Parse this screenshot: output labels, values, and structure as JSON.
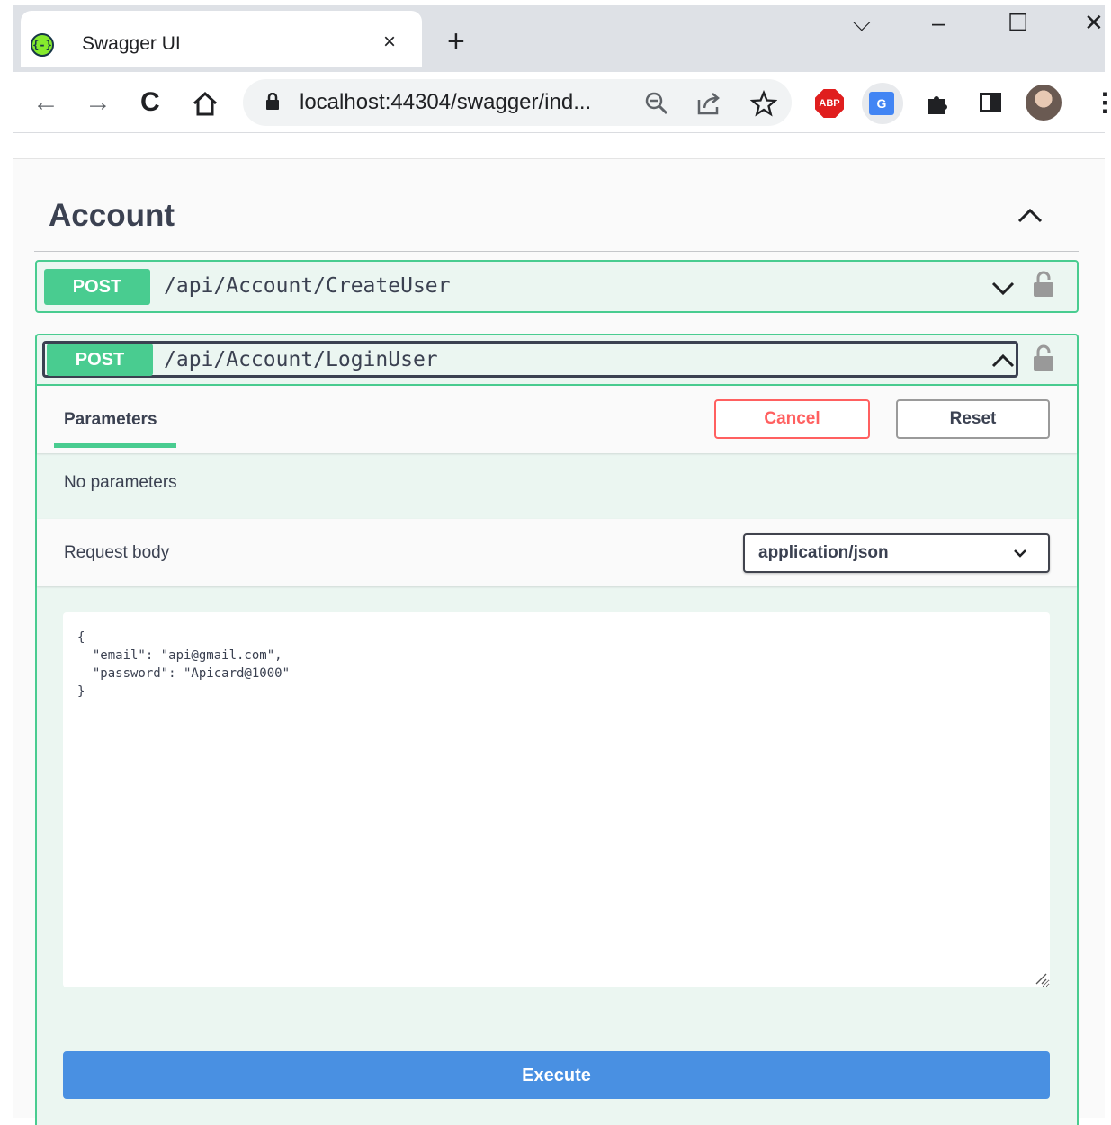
{
  "browser": {
    "tab_title": "Swagger UI",
    "tab_favicon": "{-}",
    "tab_close": "×",
    "new_tab": "+",
    "url": "localhost:44304/swagger/ind...",
    "window_controls": {
      "dropdown": "⌵",
      "minimize": "–",
      "maximize": "☐",
      "close": "✕"
    },
    "nav": {
      "back": "←",
      "forward": "→",
      "reload": "C"
    },
    "extensions": {
      "abp_label": "ABP",
      "translate_label": "G"
    }
  },
  "section": {
    "title": "Account"
  },
  "operations": [
    {
      "method": "POST",
      "path": "/api/Account/CreateUser",
      "expanded": false
    },
    {
      "method": "POST",
      "path": "/api/Account/LoginUser",
      "expanded": true
    }
  ],
  "expanded_op": {
    "parameters_tab": "Parameters",
    "cancel_label": "Cancel",
    "reset_label": "Reset",
    "no_parameters": "No parameters",
    "request_body_label": "Request body",
    "content_type": "application/json",
    "request_body_text": "{\n  \"email\": \"api@gmail.com\",\n  \"password\": \"Apicard@1000\"\n}",
    "execute_label": "Execute"
  },
  "colors": {
    "post_green": "#49cc90",
    "post_bg": "#ebf6f1",
    "cancel_red": "#ff6060",
    "execute_blue": "#4990e2",
    "text": "#3b4151"
  }
}
